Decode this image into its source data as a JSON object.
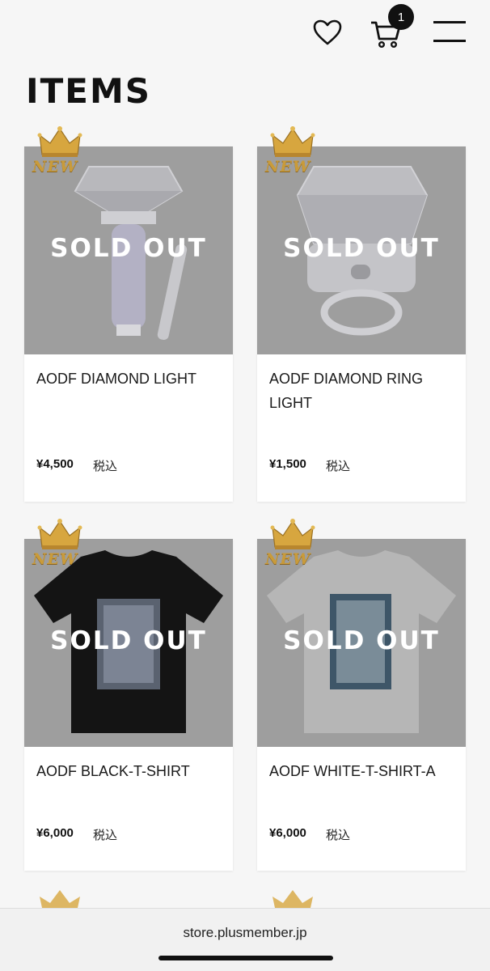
{
  "header": {
    "cart_count": "1",
    "icons": [
      "heart-icon",
      "cart-icon",
      "hamburger-menu-icon"
    ]
  },
  "page": {
    "title": "ITEMS"
  },
  "products": [
    {
      "name": "AODF DIAMOND LIGHT",
      "price": "¥4,500",
      "tax": "税込",
      "status": "SOLD OUT",
      "badge": "NEW"
    },
    {
      "name": "AODF DIAMOND RING LIGHT",
      "price": "¥1,500",
      "tax": "税込",
      "status": "SOLD OUT",
      "badge": "NEW"
    },
    {
      "name": "AODF BLACK-T-SHIRT",
      "price": "¥6,000",
      "tax": "税込",
      "status": "SOLD OUT",
      "badge": "NEW"
    },
    {
      "name": "AODF WHITE-T-SHIRT-A",
      "price": "¥6,000",
      "tax": "税込",
      "status": "SOLD OUT",
      "badge": "NEW"
    }
  ],
  "browser": {
    "url": "store.plusmember.jp"
  },
  "colors": {
    "badge_gold": "#c99b3a",
    "sold_out_overlay": "#9e9e9e"
  }
}
